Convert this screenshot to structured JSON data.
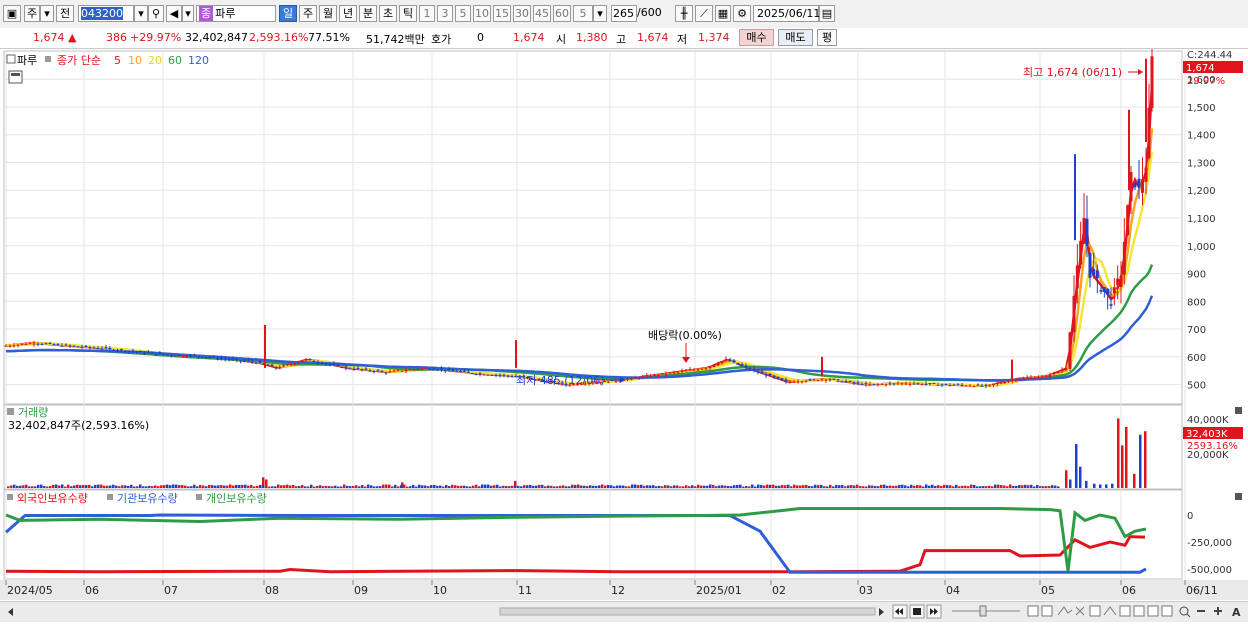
{
  "toolbar": {
    "period_type": "주",
    "prev": "전",
    "stock_code": "043200",
    "stock_badge": "종",
    "stock_name": "파루",
    "periods": [
      "일",
      "주",
      "월",
      "년",
      "분",
      "초",
      "틱"
    ],
    "selected_period": "일",
    "intervals": [
      "1",
      "3",
      "5",
      "10",
      "15",
      "30",
      "45",
      "60"
    ],
    "interval_value": "5",
    "count_value": "265",
    "count_max": "/600",
    "date_value": "2025/06/11"
  },
  "pricebar": {
    "price": "1,674",
    "change": "386",
    "change_rate": "+29.97%",
    "volume": "32,402,847",
    "volume_rate": "2,593.16%",
    "turnover": "77.51%",
    "amount": "51,742백만",
    "quote_label": "호가",
    "quote_value": "0",
    "cur_price": "1,674",
    "open_label": "시",
    "open_value": "1,380",
    "high_label": "고",
    "high_value": "1,674",
    "low_label": "저",
    "low_value": "1,374",
    "buy_label": "매수",
    "sell_label": "매도",
    "avg_label": "평"
  },
  "price_panel": {
    "name": "파루",
    "legend_label": "종가 단순",
    "ma_periods": [
      "5",
      "10",
      "20",
      "60",
      "120"
    ],
    "ma_colors": [
      "#e0141d",
      "#f5a623",
      "#f2e63a",
      "#2e9b45",
      "#2f5fd8"
    ],
    "high_annotation": "최고 1,674 (06/11)",
    "low_annotation": "최저 485 (12/06)",
    "dividend_annotation": "배당락(0.00%)",
    "current_price_tag": "1,674",
    "current_rate_tag": "29.97%",
    "top_clipped": "C:244.44",
    "y_ticks": [
      "1,600",
      "1,500",
      "1,400",
      "1,300",
      "1,200",
      "1,100",
      "1,000",
      "900",
      "800",
      "700",
      "600",
      "500"
    ]
  },
  "volume_panel": {
    "title": "거래량",
    "current": "32,402,847주(2,593.16%)",
    "y_ticks": [
      "40,000K",
      "20,000K"
    ],
    "volume_tag": "32,403K",
    "rate_tag": "2593.16%"
  },
  "holdings_panel": {
    "legends": [
      "외국인보유수량",
      "기관보유수량",
      "개인보유수량"
    ],
    "legend_colors": [
      "#e0141d",
      "#2f5fd8",
      "#2e9b45"
    ],
    "y_ticks": [
      "0",
      "-250,000",
      "-500,000"
    ]
  },
  "x_axis": {
    "labels": [
      "2024/05",
      "06",
      "07",
      "08",
      "09",
      "10",
      "11",
      "12",
      "2025/01",
      "02",
      "03",
      "04",
      "05",
      "06",
      "06/11"
    ]
  },
  "chart_data": {
    "type": "candlestick",
    "title": "",
    "xlabel": "",
    "ylabel": "",
    "ylim": [
      430,
      1680
    ],
    "candles": [
      {
        "x": 0,
        "close": 640
      },
      {
        "x": 28,
        "close": 650
      },
      {
        "x": 60,
        "close": 640
      },
      {
        "x": 100,
        "close": 630
      },
      {
        "x": 150,
        "close": 610
      },
      {
        "x": 200,
        "close": 600
      },
      {
        "x": 250,
        "close": 580
      },
      {
        "x": 270,
        "close": 560
      },
      {
        "x": 300,
        "close": 590
      },
      {
        "x": 340,
        "close": 560
      },
      {
        "x": 380,
        "close": 545
      },
      {
        "x": 420,
        "close": 560
      },
      {
        "x": 470,
        "close": 540
      },
      {
        "x": 510,
        "close": 530
      },
      {
        "x": 560,
        "close": 500
      },
      {
        "x": 610,
        "close": 515
      },
      {
        "x": 660,
        "close": 540
      },
      {
        "x": 700,
        "close": 560
      },
      {
        "x": 720,
        "close": 590
      },
      {
        "x": 740,
        "close": 560
      },
      {
        "x": 780,
        "close": 510
      },
      {
        "x": 820,
        "close": 520
      },
      {
        "x": 860,
        "close": 500
      },
      {
        "x": 900,
        "close": 505
      },
      {
        "x": 940,
        "close": 500
      },
      {
        "x": 980,
        "close": 495
      },
      {
        "x": 1010,
        "close": 520
      },
      {
        "x": 1040,
        "close": 530
      },
      {
        "x": 1060,
        "close": 560
      },
      {
        "x": 1068,
        "close": 820
      },
      {
        "x": 1078,
        "close": 1100
      },
      {
        "x": 1084,
        "close": 900
      },
      {
        "x": 1095,
        "close": 850
      },
      {
        "x": 1105,
        "close": 800
      },
      {
        "x": 1115,
        "close": 900
      },
      {
        "x": 1125,
        "close": 1250
      },
      {
        "x": 1133,
        "close": 1200
      },
      {
        "x": 1140,
        "close": 1290
      },
      {
        "x": 1146,
        "close": 1674
      }
    ],
    "high": 1674,
    "low": 485
  }
}
